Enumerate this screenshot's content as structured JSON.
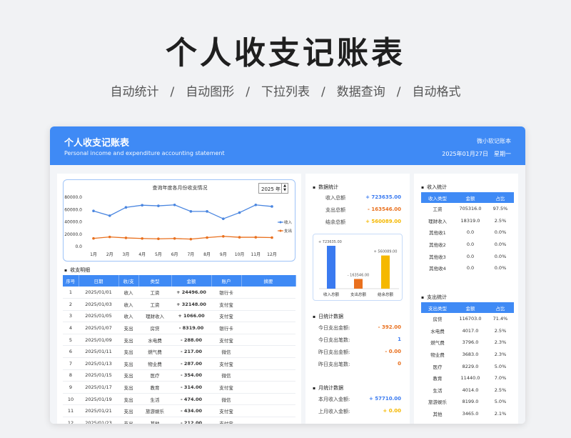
{
  "hero": {
    "title": "个人收支记账表",
    "features": [
      "自动统计",
      "自动图形",
      "下拉列表",
      "数据查询",
      "自动格式"
    ],
    "separator": "/"
  },
  "header": {
    "title": "个人收支记账表",
    "subtitle": "Personal income and expenditure accounting statement",
    "brand": "微小软记账本",
    "date": "2025年01月27日",
    "weekday": "星期一"
  },
  "colors": {
    "accent": "#3f8af5",
    "income": "#3a7af0",
    "expense": "#e9701e",
    "balance": "#f5b800"
  },
  "chart_data": {
    "type": "line",
    "title": "查询年度各月份收支情况",
    "year": "2025 年",
    "categories": [
      "1月",
      "2月",
      "3月",
      "4月",
      "5月",
      "6月",
      "7月",
      "8月",
      "9月",
      "10月",
      "11月",
      "12月"
    ],
    "series": [
      {
        "name": "收入",
        "color": "#4a86e0",
        "values": [
          57710,
          50000,
          63500,
          67000,
          66000,
          67500,
          57000,
          57000,
          45000,
          55000,
          67500,
          65000
        ]
      },
      {
        "name": "支出",
        "color": "#e9701e",
        "values": [
          13200,
          15500,
          14000,
          13000,
          12500,
          13000,
          12000,
          14500,
          16500,
          15000,
          15000,
          14500
        ]
      }
    ],
    "yticks": [
      "80000.0",
      "60000.0",
      "40000.0",
      "20000.0",
      "0.0"
    ],
    "ylim": [
      0,
      80000
    ],
    "legend": "right"
  },
  "details": {
    "title": "收支明细",
    "columns": [
      "序号",
      "日期",
      "收/支",
      "类型",
      "金额",
      "账户",
      "摘要"
    ],
    "rows": [
      {
        "no": "1",
        "date": "2025/01/01",
        "io": "收入",
        "type": "工资",
        "amount": "+ 24496.00",
        "kind": "inc",
        "account": "银行卡",
        "note": ""
      },
      {
        "no": "2",
        "date": "2025/01/03",
        "io": "收入",
        "type": "工资",
        "amount": "+ 32148.00",
        "kind": "inc",
        "account": "支付宝",
        "note": ""
      },
      {
        "no": "3",
        "date": "2025/01/05",
        "io": "收入",
        "type": "理财收入",
        "amount": "+ 1066.00",
        "kind": "inc",
        "account": "支付宝",
        "note": ""
      },
      {
        "no": "4",
        "date": "2025/01/07",
        "io": "支出",
        "type": "房贷",
        "amount": "- 8319.00",
        "kind": "exp",
        "account": "银行卡",
        "note": ""
      },
      {
        "no": "5",
        "date": "2025/01/09",
        "io": "支出",
        "type": "水电费",
        "amount": "- 288.00",
        "kind": "exp",
        "account": "支付宝",
        "note": ""
      },
      {
        "no": "6",
        "date": "2025/01/11",
        "io": "支出",
        "type": "燃气费",
        "amount": "- 217.00",
        "kind": "exp",
        "account": "微信",
        "note": ""
      },
      {
        "no": "7",
        "date": "2025/01/13",
        "io": "支出",
        "type": "物业费",
        "amount": "- 287.00",
        "kind": "exp",
        "account": "支付宝",
        "note": ""
      },
      {
        "no": "8",
        "date": "2025/01/15",
        "io": "支出",
        "type": "医疗",
        "amount": "- 354.00",
        "kind": "exp",
        "account": "微信",
        "note": ""
      },
      {
        "no": "9",
        "date": "2025/01/17",
        "io": "支出",
        "type": "教育",
        "amount": "- 314.00",
        "kind": "exp",
        "account": "支付宝",
        "note": ""
      },
      {
        "no": "10",
        "date": "2025/01/19",
        "io": "支出",
        "type": "生活",
        "amount": "- 474.00",
        "kind": "exp",
        "account": "微信",
        "note": ""
      },
      {
        "no": "11",
        "date": "2025/01/21",
        "io": "支出",
        "type": "旅游娱乐",
        "amount": "- 434.00",
        "kind": "exp",
        "account": "支付宝",
        "note": ""
      },
      {
        "no": "12",
        "date": "2025/01/23",
        "io": "支出",
        "type": "其他",
        "amount": "- 212.00",
        "kind": "exp",
        "account": "支付宝",
        "note": ""
      }
    ]
  },
  "stats": {
    "title": "数据统计",
    "income_label": "收入总额",
    "income_value": "+ 723635.00",
    "expense_label": "支出总额",
    "expense_value": "- 163546.00",
    "balance_label": "结余总额",
    "balance_value": "+ 560089.00",
    "bar_labels": [
      "收入总额",
      "支出总额",
      "结余总额"
    ],
    "bar_values": [
      723635,
      163546,
      560089
    ],
    "bar_value_labels": [
      "+ 723635.00",
      "- 163546.00",
      "+ 560089.00"
    ]
  },
  "daily": {
    "title": "日统计数据",
    "items": [
      {
        "label": "今日支出金额:",
        "value": "- 392.00",
        "kind": "exp"
      },
      {
        "label": "今日支出笔数:",
        "value": "1",
        "kind": "inc"
      },
      {
        "label": "昨日支出金额:",
        "value": "- 0.00",
        "kind": "exp"
      },
      {
        "label": "昨日支出笔数:",
        "value": "0",
        "kind": "exp"
      }
    ]
  },
  "monthly": {
    "title": "月统计数据",
    "items": [
      {
        "label": "本月收入金额:",
        "value": "+ 57710.00",
        "kind": "inc"
      },
      {
        "label": "上月收入金额:",
        "value": "+ 0.00",
        "kind": "bal"
      }
    ]
  },
  "income_stats": {
    "title": "收入统计",
    "columns": [
      "收入类型",
      "金额",
      "占比"
    ],
    "rows": [
      [
        "工资",
        "705316.0",
        "97.5%"
      ],
      [
        "理财收入",
        "18319.0",
        "2.5%"
      ],
      [
        "其他收1",
        "0.0",
        "0.0%"
      ],
      [
        "其他收2",
        "0.0",
        "0.0%"
      ],
      [
        "其他收3",
        "0.0",
        "0.0%"
      ],
      [
        "其他收4",
        "0.0",
        "0.0%"
      ]
    ]
  },
  "expense_stats": {
    "title": "支出统计",
    "columns": [
      "支出类型",
      "金额",
      "占比"
    ],
    "rows": [
      [
        "房贷",
        "116703.0",
        "71.4%"
      ],
      [
        "水电费",
        "4017.0",
        "2.5%"
      ],
      [
        "燃气费",
        "3796.0",
        "2.3%"
      ],
      [
        "物业费",
        "3683.0",
        "2.3%"
      ],
      [
        "医疗",
        "8229.0",
        "5.0%"
      ],
      [
        "教育",
        "11440.0",
        "7.0%"
      ],
      [
        "生活",
        "4014.0",
        "2.5%"
      ],
      [
        "旅游娱乐",
        "8199.0",
        "5.0%"
      ],
      [
        "其他",
        "3465.0",
        "2.1%"
      ]
    ]
  }
}
